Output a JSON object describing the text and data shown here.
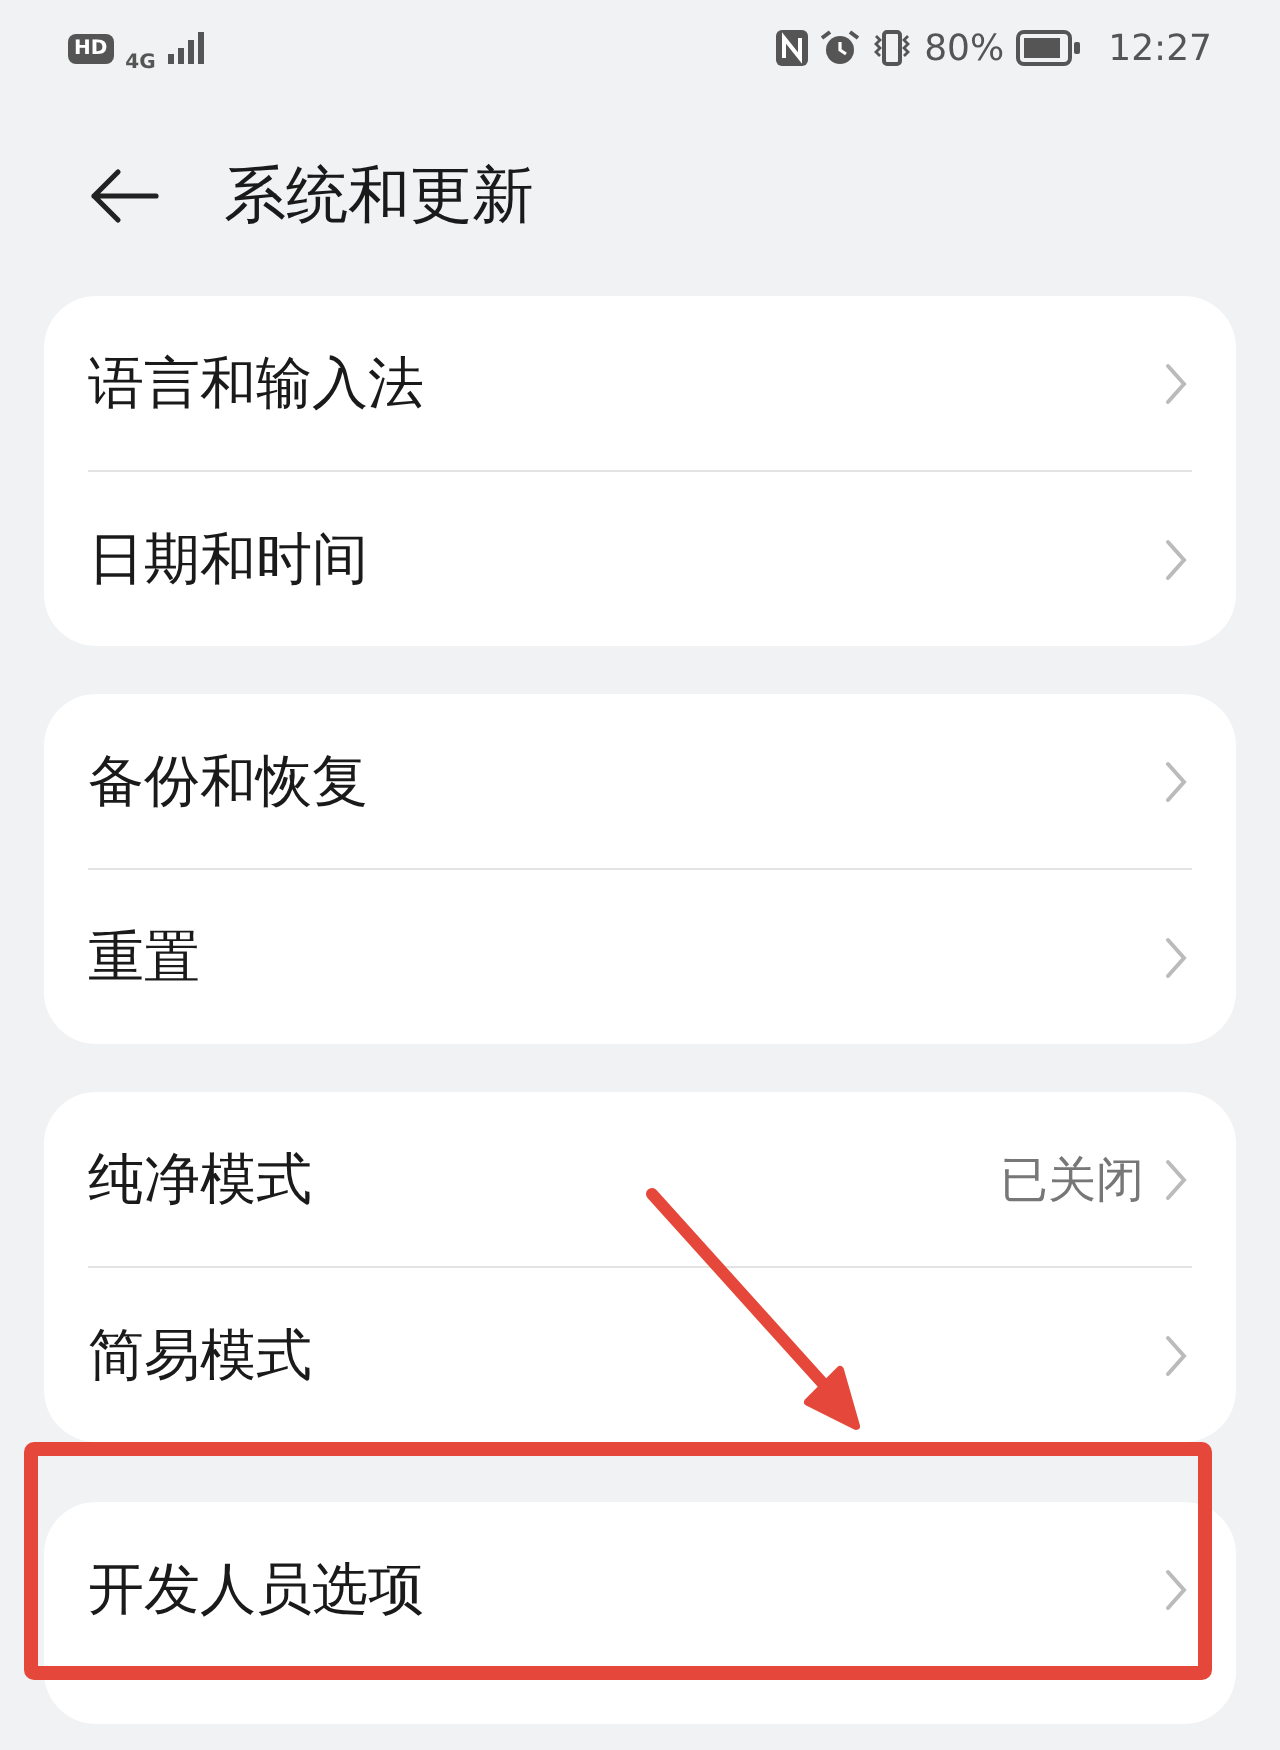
{
  "status_bar": {
    "hd": "HD",
    "network": "4G",
    "battery": "80%",
    "time": "12:27"
  },
  "header": {
    "back": true,
    "title": "系统和更新"
  },
  "sections": [
    {
      "rows": [
        {
          "label": "语言和输入法",
          "highlighted": false
        },
        {
          "label": "日期和时间",
          "highlighted": false
        }
      ]
    },
    {
      "rows": [
        {
          "label": "备份和恢复",
          "highlighted": false
        },
        {
          "label": "重置",
          "highlighted": false
        }
      ]
    },
    {
      "rows": [
        {
          "label": "纯净模式",
          "value": "已关闭",
          "highlighted": false
        },
        {
          "label": "简易模式",
          "highlighted": false
        }
      ]
    },
    {
      "rows": [
        {
          "label": "开发人员选项",
          "highlighted": true
        }
      ]
    }
  ]
}
